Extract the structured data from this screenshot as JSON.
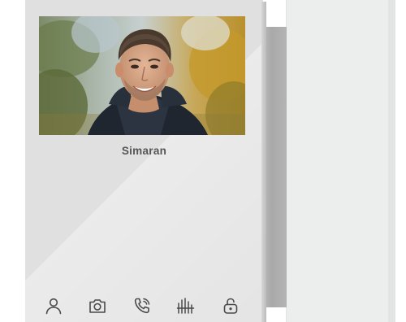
{
  "caller": {
    "name": "Simaran"
  },
  "toolbar": {
    "items": [
      {
        "icon": "user-icon"
      },
      {
        "icon": "camera-icon"
      },
      {
        "icon": "phone-icon"
      },
      {
        "icon": "volume-icon"
      },
      {
        "icon": "unlock-icon"
      }
    ]
  },
  "colors": {
    "device_body": "#e0e0e0",
    "icon_stroke": "#4a4a4a",
    "name_text": "#555555",
    "side_panel": "#eceded"
  }
}
